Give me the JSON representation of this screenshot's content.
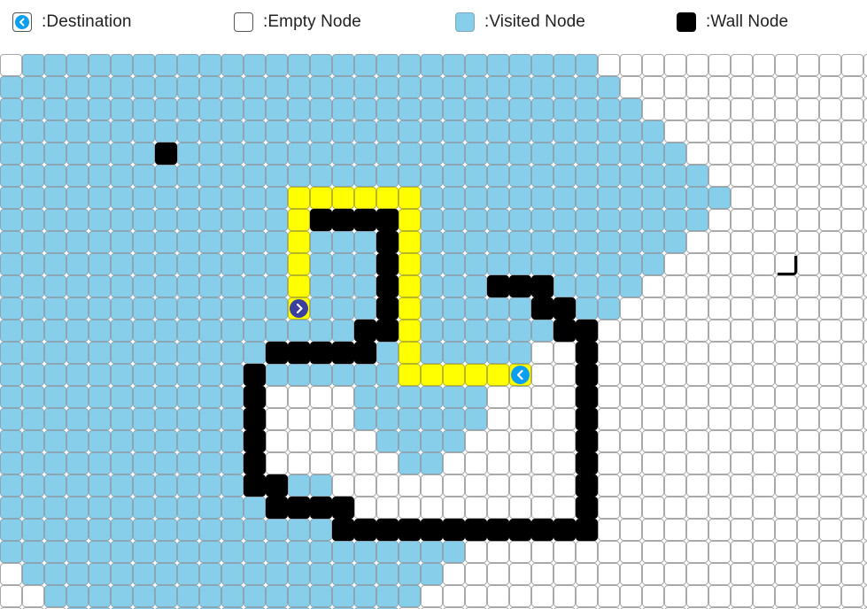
{
  "legend": {
    "destination": {
      "label": ":Destination",
      "icon": "chevron-left-icon",
      "color": "#0a9ff2"
    },
    "empty": {
      "label": ":Empty Node",
      "color": "#ffffff"
    },
    "visited": {
      "label": ":Visited Node",
      "color": "#87ceeb"
    },
    "wall": {
      "label": ":Wall Node",
      "color": "#000000"
    }
  },
  "colors": {
    "visited": "#87ceeb",
    "path": "#ffff00",
    "wall": "#000000",
    "start_marker": "#3b3f9e",
    "destination_marker": "#0a9ff2"
  },
  "grid": {
    "rows": 26,
    "cols": 40,
    "visited_spans": [
      [
        [
          1,
          26
        ]
      ],
      [
        [
          0,
          27
        ]
      ],
      [
        [
          0,
          28
        ]
      ],
      [
        [
          0,
          29
        ]
      ],
      [
        [
          0,
          30
        ]
      ],
      [
        [
          0,
          31
        ]
      ],
      [
        [
          0,
          32
        ]
      ],
      [
        [
          0,
          31
        ]
      ],
      [
        [
          0,
          30
        ]
      ],
      [
        [
          0,
          29
        ]
      ],
      [
        [
          0,
          28
        ]
      ],
      [
        [
          0,
          27
        ]
      ],
      [
        [
          0,
          26
        ]
      ],
      [
        [
          0,
          25
        ]
      ],
      [
        [
          0,
          24
        ]
      ],
      [
        [
          0,
          11
        ],
        [
          16,
          22
        ]
      ],
      [
        [
          0,
          11
        ],
        [
          16,
          21
        ]
      ],
      [
        [
          0,
          11
        ],
        [
          17,
          20
        ]
      ],
      [
        [
          0,
          11
        ],
        [
          18,
          19
        ]
      ],
      [
        [
          0,
          14
        ]
      ],
      [
        [
          0,
          15
        ]
      ],
      [
        [
          0,
          20
        ]
      ],
      [
        [
          0,
          20
        ]
      ],
      [
        [
          1,
          19
        ]
      ],
      [
        [
          2,
          18
        ]
      ],
      [
        [
          3,
          17
        ]
      ]
    ],
    "white_cells": [
      [
        13,
        13
      ],
      [
        13,
        24
      ],
      [
        13,
        25
      ],
      [
        14,
        24
      ],
      [
        14,
        25
      ],
      [
        15,
        12
      ],
      [
        15,
        13
      ],
      [
        15,
        14
      ],
      [
        15,
        22
      ],
      [
        15,
        23
      ],
      [
        15,
        24
      ],
      [
        15,
        25
      ],
      [
        16,
        13
      ],
      [
        16,
        14
      ],
      [
        16,
        22
      ],
      [
        16,
        23
      ],
      [
        16,
        24
      ],
      [
        16,
        25
      ],
      [
        17,
        13
      ],
      [
        17,
        14
      ],
      [
        17,
        15
      ],
      [
        17,
        21
      ],
      [
        17,
        22
      ],
      [
        17,
        23
      ],
      [
        17,
        24
      ],
      [
        17,
        25
      ],
      [
        18,
        14
      ],
      [
        18,
        15
      ],
      [
        18,
        16
      ],
      [
        18,
        17
      ],
      [
        18,
        20
      ],
      [
        18,
        21
      ],
      [
        18,
        22
      ],
      [
        18,
        23
      ],
      [
        18,
        24
      ],
      [
        18,
        25
      ],
      [
        19,
        15
      ],
      [
        19,
        16
      ],
      [
        19,
        17
      ],
      [
        19,
        20
      ],
      [
        19,
        21
      ],
      [
        19,
        22
      ],
      [
        19,
        23
      ],
      [
        19,
        24
      ],
      [
        19,
        25
      ],
      [
        20,
        13
      ],
      [
        20,
        14
      ],
      [
        20,
        15
      ],
      [
        20,
        16
      ],
      [
        20,
        17
      ],
      [
        20,
        18
      ],
      [
        20,
        19
      ],
      [
        20,
        20
      ],
      [
        20,
        21
      ],
      [
        20,
        22
      ],
      [
        20,
        23
      ],
      [
        20,
        24
      ],
      [
        20,
        25
      ]
    ],
    "wall_cells": [
      [
        4,
        7
      ],
      [
        7,
        14
      ],
      [
        7,
        15
      ],
      [
        7,
        16
      ],
      [
        7,
        17
      ],
      [
        8,
        17
      ],
      [
        9,
        17
      ],
      [
        10,
        17
      ],
      [
        11,
        17
      ],
      [
        10,
        22
      ],
      [
        10,
        23
      ],
      [
        10,
        24
      ],
      [
        11,
        24
      ],
      [
        11,
        25
      ],
      [
        12,
        16
      ],
      [
        12,
        17
      ],
      [
        12,
        25
      ],
      [
        12,
        26
      ],
      [
        13,
        12
      ],
      [
        13,
        13
      ],
      [
        13,
        14
      ],
      [
        13,
        15
      ],
      [
        13,
        16
      ],
      [
        13,
        26
      ],
      [
        14,
        11
      ],
      [
        14,
        26
      ],
      [
        15,
        11
      ],
      [
        15,
        26
      ],
      [
        16,
        11
      ],
      [
        16,
        26
      ],
      [
        17,
        11
      ],
      [
        17,
        26
      ],
      [
        18,
        11
      ],
      [
        18,
        26
      ],
      [
        19,
        11
      ],
      [
        19,
        12
      ],
      [
        19,
        26
      ],
      [
        20,
        12
      ],
      [
        20,
        13
      ],
      [
        20,
        14
      ],
      [
        20,
        15
      ],
      [
        20,
        26
      ],
      [
        21,
        15
      ],
      [
        21,
        16
      ],
      [
        21,
        17
      ],
      [
        21,
        18
      ],
      [
        21,
        19
      ],
      [
        21,
        20
      ],
      [
        21,
        21
      ],
      [
        21,
        22
      ],
      [
        21,
        23
      ],
      [
        21,
        24
      ],
      [
        21,
        25
      ],
      [
        21,
        26
      ]
    ],
    "path_cells": [
      [
        6,
        13
      ],
      [
        6,
        14
      ],
      [
        6,
        15
      ],
      [
        6,
        16
      ],
      [
        6,
        17
      ],
      [
        6,
        18
      ],
      [
        7,
        13
      ],
      [
        7,
        18
      ],
      [
        8,
        13
      ],
      [
        8,
        18
      ],
      [
        9,
        13
      ],
      [
        9,
        18
      ],
      [
        10,
        13
      ],
      [
        10,
        18
      ],
      [
        11,
        18
      ],
      [
        12,
        18
      ],
      [
        13,
        18
      ],
      [
        14,
        18
      ],
      [
        14,
        19
      ],
      [
        14,
        20
      ],
      [
        14,
        21
      ],
      [
        14,
        22
      ]
    ],
    "special_cells": [
      [
        9,
        35
      ]
    ],
    "start": {
      "row": 11,
      "col": 13,
      "icon": "chevron-right-icon"
    },
    "destination": {
      "row": 14,
      "col": 23,
      "icon": "chevron-left-icon"
    }
  }
}
